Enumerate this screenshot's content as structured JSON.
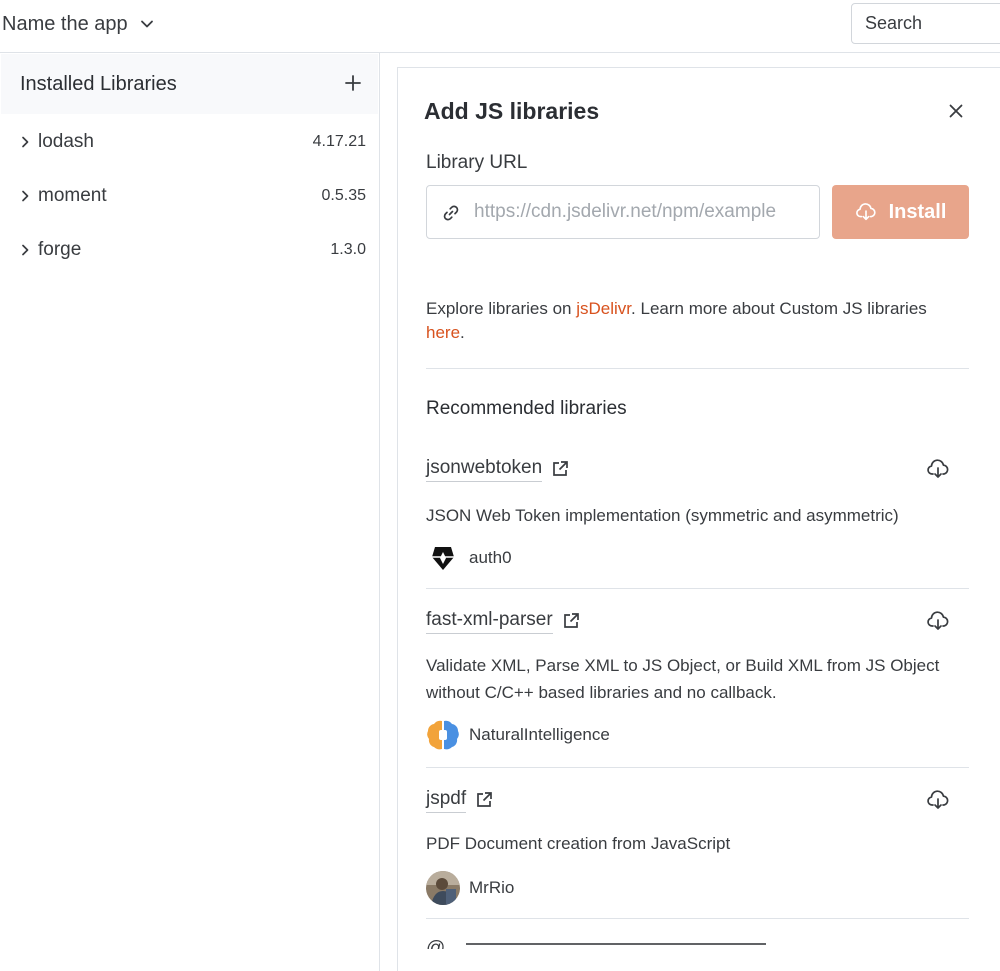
{
  "header": {
    "app_name": "Name the app",
    "search_label": "Search"
  },
  "sidebar": {
    "title": "Installed Libraries",
    "libraries": [
      {
        "name": "lodash",
        "version": "4.17.21"
      },
      {
        "name": "moment",
        "version": "0.5.35"
      },
      {
        "name": "forge",
        "version": "1.3.0"
      }
    ]
  },
  "panel": {
    "title": "Add JS libraries",
    "url_label": "Library URL",
    "url_placeholder": "https://cdn.jsdelivr.net/npm/example",
    "url_value": "",
    "install_label": "Install",
    "install_color": "#e8a58b",
    "explore": {
      "prefix": "Explore libraries on ",
      "jsdelivr_link": "jsDelivr",
      "middle": ". Learn more about Custom JS libraries ",
      "here_link": "here",
      "suffix": "."
    },
    "link_color": "#d8521e",
    "recommended_title": "Recommended libraries",
    "recommended": [
      {
        "name": "jsonwebtoken",
        "description": "JSON Web Token implementation (symmetric and asymmetric)",
        "author": "auth0",
        "avatar_icon": "auth0-shield-icon"
      },
      {
        "name": "fast-xml-parser",
        "description": "Validate XML, Parse XML to JS Object, or Build XML from JS Object without C/C++ based libraries and no callback.",
        "author": "NaturalIntelligence",
        "avatar_icon": "brain-avatar-icon"
      },
      {
        "name": "jspdf",
        "description": "PDF Document creation from JavaScript",
        "author": "MrRio",
        "avatar_icon": "photo-avatar"
      },
      {
        "name": "@ ... ",
        "description": "",
        "author": "",
        "avatar_icon": ""
      }
    ]
  }
}
